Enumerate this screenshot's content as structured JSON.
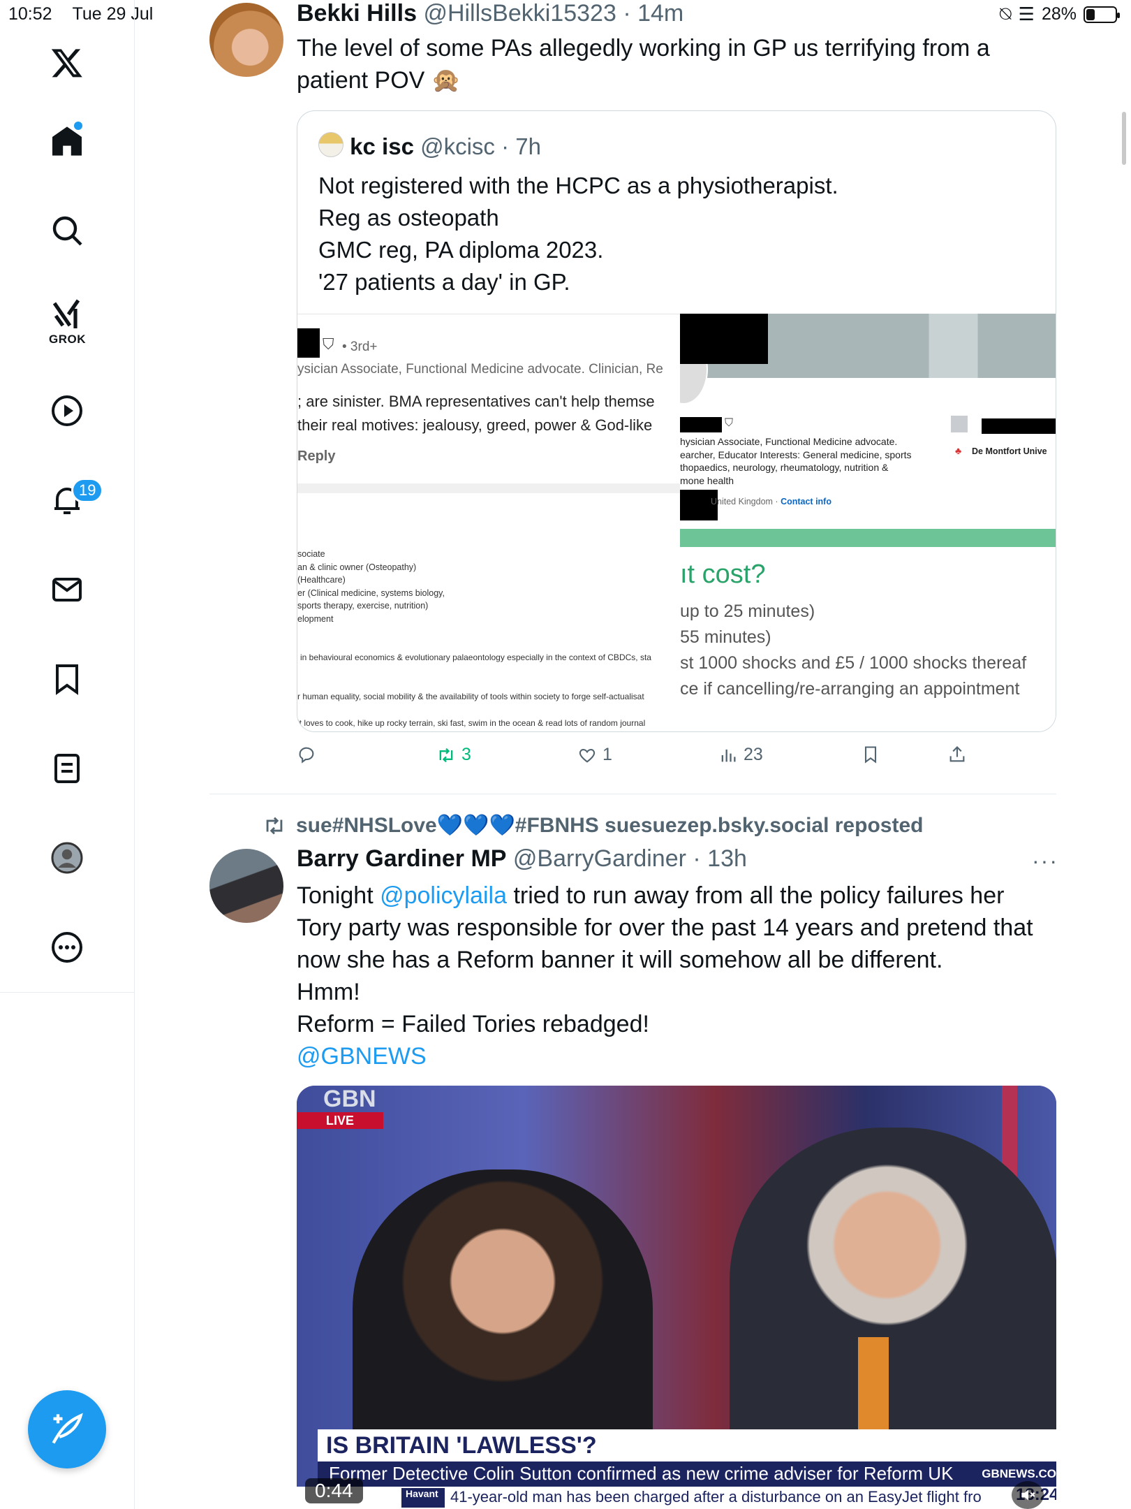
{
  "status_bar": {
    "time": "10:52",
    "date": "Tue 29 Jul",
    "battery": "28%",
    "battery_fraction": 0.28
  },
  "sidebar": {
    "items": [
      {
        "label": "Home",
        "icon": "home-icon"
      },
      {
        "label": "Search",
        "icon": "search-icon"
      },
      {
        "label": "GROK",
        "icon": "grok-icon"
      },
      {
        "label": "Video",
        "icon": "play-icon"
      },
      {
        "label": "Notifications",
        "icon": "bell-icon"
      },
      {
        "label": "Messages",
        "icon": "mail-icon"
      },
      {
        "label": "Bookmarks",
        "icon": "bookmark-icon"
      },
      {
        "label": "Lists",
        "icon": "list-icon"
      },
      {
        "label": "Profile",
        "icon": "profile-icon"
      },
      {
        "label": "More",
        "icon": "more-icon"
      }
    ],
    "grok_label": "GROK",
    "notifications_badge": "19"
  },
  "tweet1": {
    "name": "Bekki Hills",
    "handle": "@HillsBekki15323",
    "time": "· 14m",
    "text_line1": "The level of some PAs allegedly working in GP us terrifying from a",
    "text_line2": "patient POV 🙊",
    "quote": {
      "name": "kc isc",
      "handle": "@kcisc",
      "time": "· 7h",
      "lines": [
        "Not registered with the HCPC as a physiotherapist.",
        "Reg as osteopath",
        "GMC reg, PA diploma 2023.",
        "'27 patients a day' in GP."
      ],
      "left_image": {
        "degree": "• 3rd+",
        "headline": "ysician Associate, Functional Medicine advocate. Clinician, Re",
        "comment1": "; are sinister. BMA representatives can't help themse",
        "comment2": "their real motives: jealousy, greed, power & God-like",
        "reply": "Reply",
        "about": [
          "sociate",
          "an & clinic owner (Osteopathy)",
          "(Healthcare)",
          "er (Clinical medicine, systems biology,",
          "sports therapy, exercise, nutrition)",
          "elopment"
        ],
        "interest1": "in behavioural economics & evolutionary palaeontology especially in the context of CBDCs, sta",
        "interest2": "r human equality, social mobility & the availability of tools within society to forge self-actualisat",
        "interest3": "it loves to cook, hike up rocky terrain, ski fast, swim in the ocean & read lots of random journal"
      },
      "right_image": {
        "profile_lines": [
          "hysician Associate, Functional Medicine advocate.",
          "earcher, Educator Interests: General medicine, sports",
          "thopaedics, neurology, rheumatology, nutrition &",
          "mone health"
        ],
        "location": "United Kingdom ·",
        "contact": "Contact info",
        "university": "De Montfort Unive",
        "price_heading": "ıt cost?",
        "price_lines": [
          "up to 25 minutes)",
          "55 minutes)",
          "st 1000 shocks and £5 / 1000 shocks thereaf",
          "ce if cancelling/re-arranging an appointment"
        ]
      }
    },
    "actions": {
      "retweets": "3",
      "likes": "1",
      "views": "23"
    }
  },
  "tweet2": {
    "reposted_by": "sue#NHSLove💙💙💙#FBNHS suesuezep.bsky.social reposted",
    "name": "Barry Gardiner MP",
    "handle": "@BarryGardiner",
    "time": "· 13h",
    "more": "···",
    "text": {
      "l1a": "Tonight ",
      "mention": "@policylaila",
      "l1b": " tried to run away from all the policy failures her",
      "l2": "Tory party was responsible for over the past 14 years and pretend that",
      "l3": "now she has a Reform banner it will somehow all be different.",
      "l4": "Hmm!",
      "l5": "Reform = Failed Tories rebadged!",
      "l6": "@GBNEWS"
    },
    "video": {
      "logo": "GBN",
      "live": "LIVE",
      "headline": "IS BRITAIN 'LAWLESS'?",
      "subheadline": "Former Detective Colin Sutton confirmed as new crime adviser for Reform UK",
      "site": "GBNEWS.CO",
      "duration": "0:44",
      "ticker_place": "Havant",
      "ticker": "41-year-old man has been charged after a disturbance on an EasyJet flight fro",
      "clock": "18:24"
    }
  },
  "colors": {
    "accent": "#1d9bf0",
    "retweet_green": "#00ba7c",
    "text_secondary": "#536471"
  }
}
